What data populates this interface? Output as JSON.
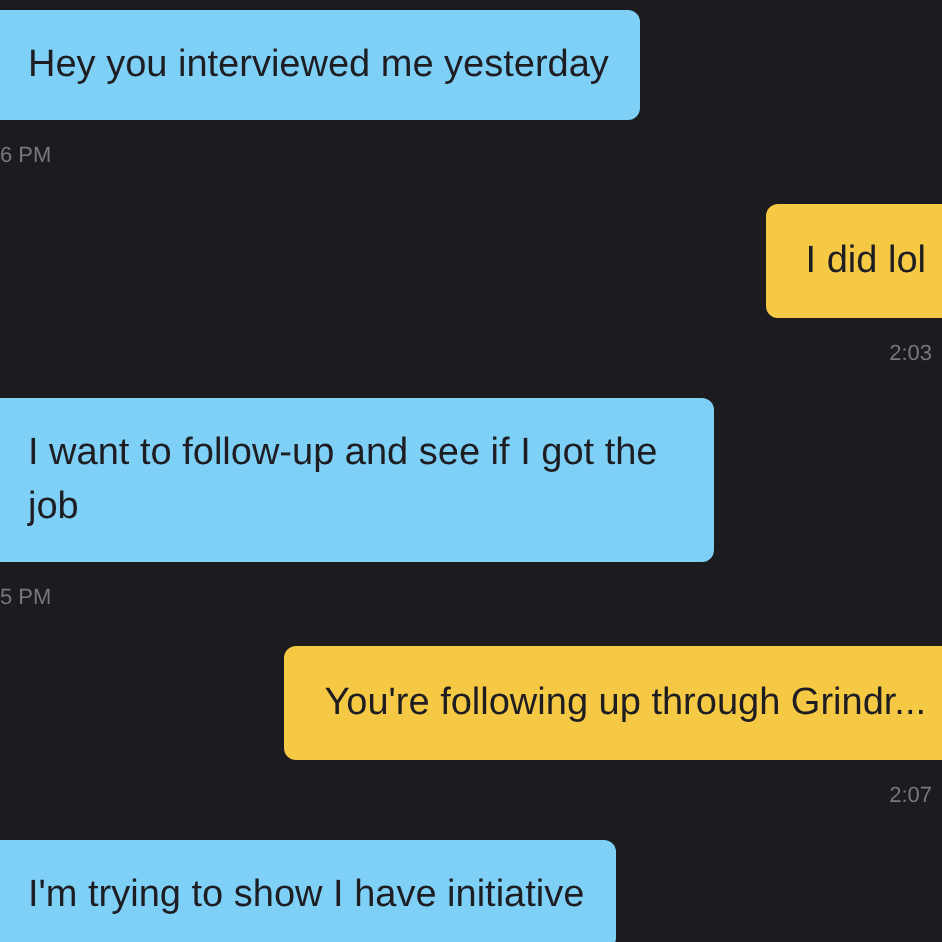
{
  "messages": [
    {
      "kind": "incoming",
      "text": "Hey you interviewed me yesterday",
      "time": "6 PM"
    },
    {
      "kind": "outgoing",
      "text": "I did lol",
      "time": "2:03"
    },
    {
      "kind": "incoming",
      "text": "I want to follow-up and see if I got the job",
      "time": "5 PM"
    },
    {
      "kind": "outgoing",
      "text": "You're following up through Grindr...",
      "time": "2:07"
    },
    {
      "kind": "incoming",
      "text": "I'm trying to show I have initiative"
    }
  ]
}
